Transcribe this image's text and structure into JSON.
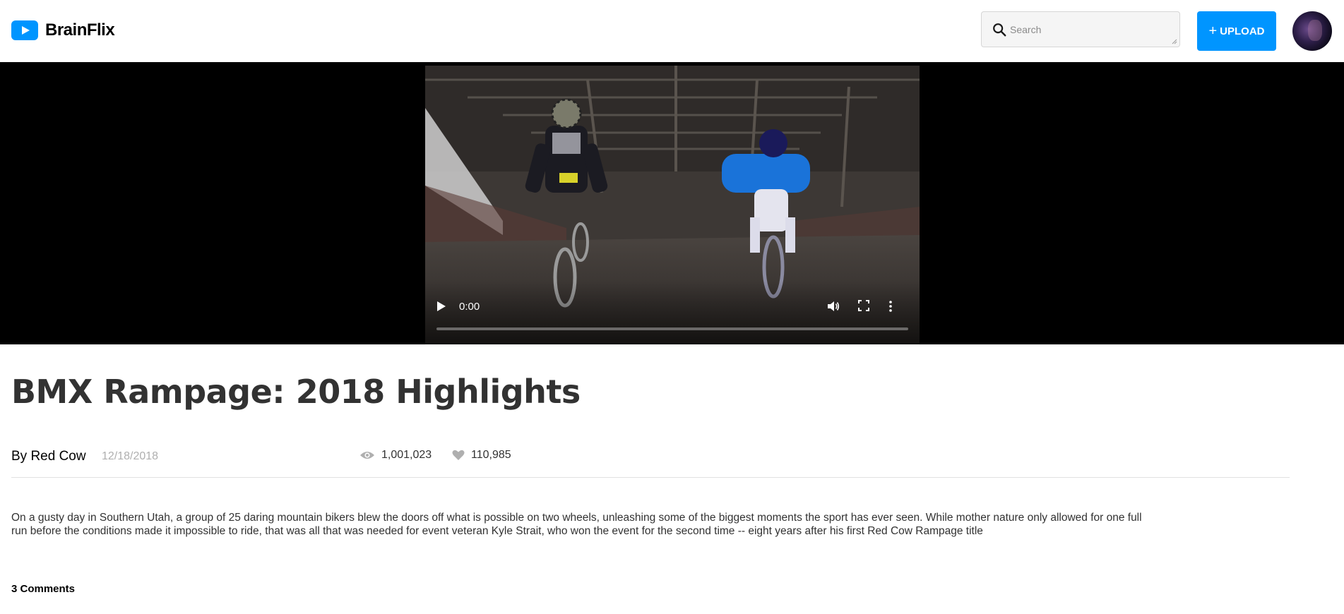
{
  "app": {
    "name": "BrainFlix"
  },
  "header": {
    "search_placeholder": "Search",
    "upload_label": "UPLOAD",
    "icons": {
      "logo": "play-icon",
      "search": "search-icon",
      "upload": "plus-icon"
    }
  },
  "video": {
    "current_time": "0:00",
    "progress": 0,
    "icons": {
      "play": "play-icon",
      "volume": "volume-icon",
      "fullscreen": "fullscreen-icon",
      "more": "more-vertical-icon"
    }
  },
  "details": {
    "title": "BMX Rampage: 2018 Highlights",
    "author": "By Red Cow",
    "date": "12/18/2018",
    "views": "1,001,023",
    "likes": "110,985",
    "description": "On a gusty day in Southern Utah, a group of 25 daring mountain bikers blew the doors off what is possible on two wheels, unleashing some of the biggest moments the sport has ever seen. While mother nature only allowed for one full run before the conditions made it impossible to ride, that was all that was needed for event veteran Kyle Strait, who won the event for the second time -- eight years after his first Red Cow Rampage title",
    "icons": {
      "views": "eye-icon",
      "likes": "heart-icon"
    }
  },
  "comments": {
    "count_label": "3 Comments"
  },
  "colors": {
    "brand": "#0095ff",
    "text": "#323232",
    "muted": "#afafaf"
  }
}
